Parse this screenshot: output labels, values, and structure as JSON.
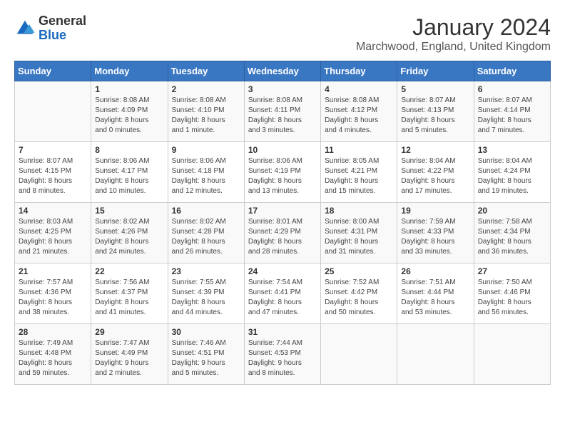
{
  "logo": {
    "general": "General",
    "blue": "Blue"
  },
  "title": "January 2024",
  "subtitle": "Marchwood, England, United Kingdom",
  "days_header": [
    "Sunday",
    "Monday",
    "Tuesday",
    "Wednesday",
    "Thursday",
    "Friday",
    "Saturday"
  ],
  "weeks": [
    [
      {
        "num": "",
        "info": ""
      },
      {
        "num": "1",
        "info": "Sunrise: 8:08 AM\nSunset: 4:09 PM\nDaylight: 8 hours\nand 0 minutes."
      },
      {
        "num": "2",
        "info": "Sunrise: 8:08 AM\nSunset: 4:10 PM\nDaylight: 8 hours\nand 1 minute."
      },
      {
        "num": "3",
        "info": "Sunrise: 8:08 AM\nSunset: 4:11 PM\nDaylight: 8 hours\nand 3 minutes."
      },
      {
        "num": "4",
        "info": "Sunrise: 8:08 AM\nSunset: 4:12 PM\nDaylight: 8 hours\nand 4 minutes."
      },
      {
        "num": "5",
        "info": "Sunrise: 8:07 AM\nSunset: 4:13 PM\nDaylight: 8 hours\nand 5 minutes."
      },
      {
        "num": "6",
        "info": "Sunrise: 8:07 AM\nSunset: 4:14 PM\nDaylight: 8 hours\nand 7 minutes."
      }
    ],
    [
      {
        "num": "7",
        "info": "Sunrise: 8:07 AM\nSunset: 4:15 PM\nDaylight: 8 hours\nand 8 minutes."
      },
      {
        "num": "8",
        "info": "Sunrise: 8:06 AM\nSunset: 4:17 PM\nDaylight: 8 hours\nand 10 minutes."
      },
      {
        "num": "9",
        "info": "Sunrise: 8:06 AM\nSunset: 4:18 PM\nDaylight: 8 hours\nand 12 minutes."
      },
      {
        "num": "10",
        "info": "Sunrise: 8:06 AM\nSunset: 4:19 PM\nDaylight: 8 hours\nand 13 minutes."
      },
      {
        "num": "11",
        "info": "Sunrise: 8:05 AM\nSunset: 4:21 PM\nDaylight: 8 hours\nand 15 minutes."
      },
      {
        "num": "12",
        "info": "Sunrise: 8:04 AM\nSunset: 4:22 PM\nDaylight: 8 hours\nand 17 minutes."
      },
      {
        "num": "13",
        "info": "Sunrise: 8:04 AM\nSunset: 4:24 PM\nDaylight: 8 hours\nand 19 minutes."
      }
    ],
    [
      {
        "num": "14",
        "info": "Sunrise: 8:03 AM\nSunset: 4:25 PM\nDaylight: 8 hours\nand 21 minutes."
      },
      {
        "num": "15",
        "info": "Sunrise: 8:02 AM\nSunset: 4:26 PM\nDaylight: 8 hours\nand 24 minutes."
      },
      {
        "num": "16",
        "info": "Sunrise: 8:02 AM\nSunset: 4:28 PM\nDaylight: 8 hours\nand 26 minutes."
      },
      {
        "num": "17",
        "info": "Sunrise: 8:01 AM\nSunset: 4:29 PM\nDaylight: 8 hours\nand 28 minutes."
      },
      {
        "num": "18",
        "info": "Sunrise: 8:00 AM\nSunset: 4:31 PM\nDaylight: 8 hours\nand 31 minutes."
      },
      {
        "num": "19",
        "info": "Sunrise: 7:59 AM\nSunset: 4:33 PM\nDaylight: 8 hours\nand 33 minutes."
      },
      {
        "num": "20",
        "info": "Sunrise: 7:58 AM\nSunset: 4:34 PM\nDaylight: 8 hours\nand 36 minutes."
      }
    ],
    [
      {
        "num": "21",
        "info": "Sunrise: 7:57 AM\nSunset: 4:36 PM\nDaylight: 8 hours\nand 38 minutes."
      },
      {
        "num": "22",
        "info": "Sunrise: 7:56 AM\nSunset: 4:37 PM\nDaylight: 8 hours\nand 41 minutes."
      },
      {
        "num": "23",
        "info": "Sunrise: 7:55 AM\nSunset: 4:39 PM\nDaylight: 8 hours\nand 44 minutes."
      },
      {
        "num": "24",
        "info": "Sunrise: 7:54 AM\nSunset: 4:41 PM\nDaylight: 8 hours\nand 47 minutes."
      },
      {
        "num": "25",
        "info": "Sunrise: 7:52 AM\nSunset: 4:42 PM\nDaylight: 8 hours\nand 50 minutes."
      },
      {
        "num": "26",
        "info": "Sunrise: 7:51 AM\nSunset: 4:44 PM\nDaylight: 8 hours\nand 53 minutes."
      },
      {
        "num": "27",
        "info": "Sunrise: 7:50 AM\nSunset: 4:46 PM\nDaylight: 8 hours\nand 56 minutes."
      }
    ],
    [
      {
        "num": "28",
        "info": "Sunrise: 7:49 AM\nSunset: 4:48 PM\nDaylight: 8 hours\nand 59 minutes."
      },
      {
        "num": "29",
        "info": "Sunrise: 7:47 AM\nSunset: 4:49 PM\nDaylight: 9 hours\nand 2 minutes."
      },
      {
        "num": "30",
        "info": "Sunrise: 7:46 AM\nSunset: 4:51 PM\nDaylight: 9 hours\nand 5 minutes."
      },
      {
        "num": "31",
        "info": "Sunrise: 7:44 AM\nSunset: 4:53 PM\nDaylight: 9 hours\nand 8 minutes."
      },
      {
        "num": "",
        "info": ""
      },
      {
        "num": "",
        "info": ""
      },
      {
        "num": "",
        "info": ""
      }
    ]
  ]
}
